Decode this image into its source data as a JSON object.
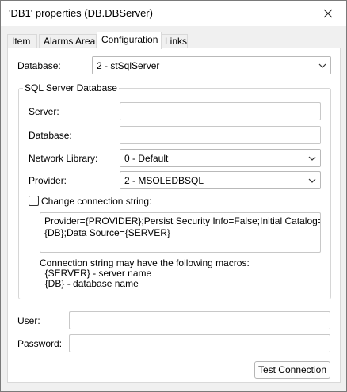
{
  "window": {
    "title": "'DB1' properties (DB.DBServer)"
  },
  "tabs": [
    {
      "label": "Item"
    },
    {
      "label": "Alarms Area"
    },
    {
      "label": "Configuration"
    },
    {
      "label": "Links"
    }
  ],
  "active_tab": "Configuration",
  "database": {
    "label": "Database:",
    "selected": "2 - stSqlServer"
  },
  "sql_group": {
    "legend": "SQL Server Database",
    "server": {
      "label": "Server:",
      "value": ""
    },
    "database": {
      "label": "Database:",
      "value": ""
    },
    "network_library": {
      "label": "Network Library:",
      "selected": "0 - Default"
    },
    "provider": {
      "label": "Provider:",
      "selected": "2 - MSOLEDBSQL"
    },
    "change_conn": {
      "label": "Change connection string:",
      "checked": false
    },
    "connection_string": [
      "Provider={PROVIDER};Persist Security Info=False;Initial Catalog=",
      "{DB};Data Source={SERVER}"
    ],
    "macros_note": [
      "Connection string may have the following macros:",
      "  {SERVER} - server name",
      "  {DB} - database name"
    ]
  },
  "user": {
    "label": "User:",
    "value": ""
  },
  "password": {
    "label": "Password:",
    "value": ""
  },
  "test_button": {
    "label": "Test Connection"
  },
  "icons": {
    "close": "close-icon",
    "dropdown": "chevron-down-icon"
  }
}
